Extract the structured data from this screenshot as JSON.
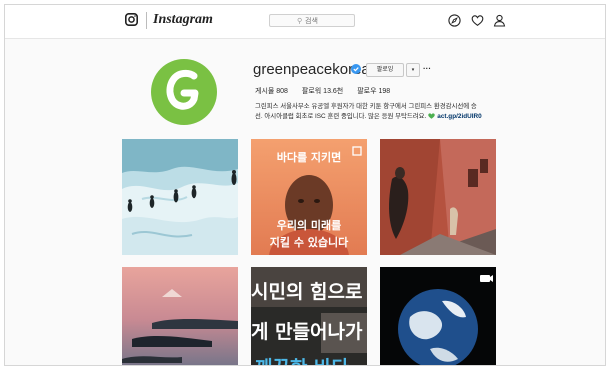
{
  "app": {
    "wordmark": "Instagram"
  },
  "search": {
    "placeholder": "검색"
  },
  "nav": {
    "icons": [
      "compass-icon",
      "heart-icon",
      "person-icon"
    ]
  },
  "profile": {
    "username": "greenpeacekorea",
    "avatar_letter": "G",
    "follow_label": "팔로잉",
    "dropdown_label": "▾",
    "more_label": "···",
    "stats": {
      "posts": "게시물 808",
      "followers": "팔로워 13.6천",
      "following": "팔로우 198"
    },
    "bio_line1": "그린피스 서울사무소 유공엘 후원자가 대한 키툰 항구에서 그린피스 환경감시선에 승",
    "bio_line2": "선. 아시아클럽 회초로 ISC 훈련 중입니다. 많은 응원 부탁드려요.",
    "bio_link": "act.gp/2idUIR0"
  },
  "posts": [
    {
      "overlay": []
    },
    {
      "overlay": [
        "바다를 지키면",
        "우리의 미래를",
        "지킬 수 있습니다"
      ]
    },
    {
      "overlay": []
    },
    {
      "overlay": []
    },
    {
      "overlay": [
        "시민의 힘으로",
        "게 만들어나가",
        "깨끗한 바다"
      ]
    },
    {
      "overlay": []
    }
  ],
  "colors": {
    "accent": "#3897f0",
    "avatar_green": "#7ac143",
    "link": "#003569"
  }
}
